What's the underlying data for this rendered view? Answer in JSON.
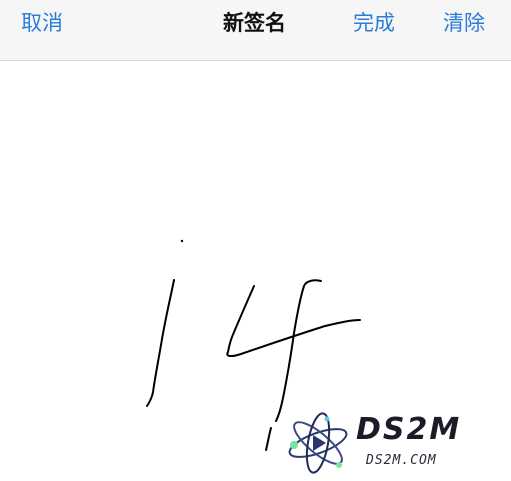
{
  "navbar": {
    "cancel_label": "取消",
    "title": "新签名",
    "done_label": "完成",
    "clear_label": "清除"
  },
  "watermark": {
    "main_text": "DS2M",
    "sub_text": "DS2M.COM"
  },
  "colors": {
    "accent": "#2b7cd9",
    "title": "#111111",
    "navbar_bg": "#f6f6f6",
    "ink": "#000000"
  },
  "icons": {
    "logo": "atom-logo-icon"
  }
}
